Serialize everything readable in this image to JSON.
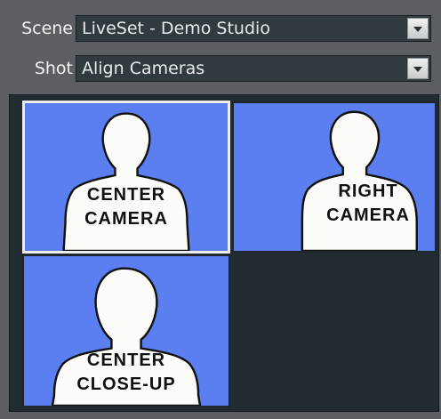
{
  "scene": {
    "label": "Scene",
    "value": "LiveSet - Demo Studio"
  },
  "shot": {
    "label": "Shot",
    "value": "Align Cameras"
  },
  "cameras": [
    {
      "line1": "CENTER",
      "line2": "CAMERA",
      "selected": true
    },
    {
      "line1": "RIGHT",
      "line2": "CAMERA",
      "selected": false
    },
    {
      "line1": "CENTER",
      "line2": "CLOSE-UP",
      "selected": false
    }
  ],
  "colors": {
    "tile_bg": "#5b7ff0",
    "panel_bg": "#5b5f63",
    "grid_bg": "#222b30"
  }
}
